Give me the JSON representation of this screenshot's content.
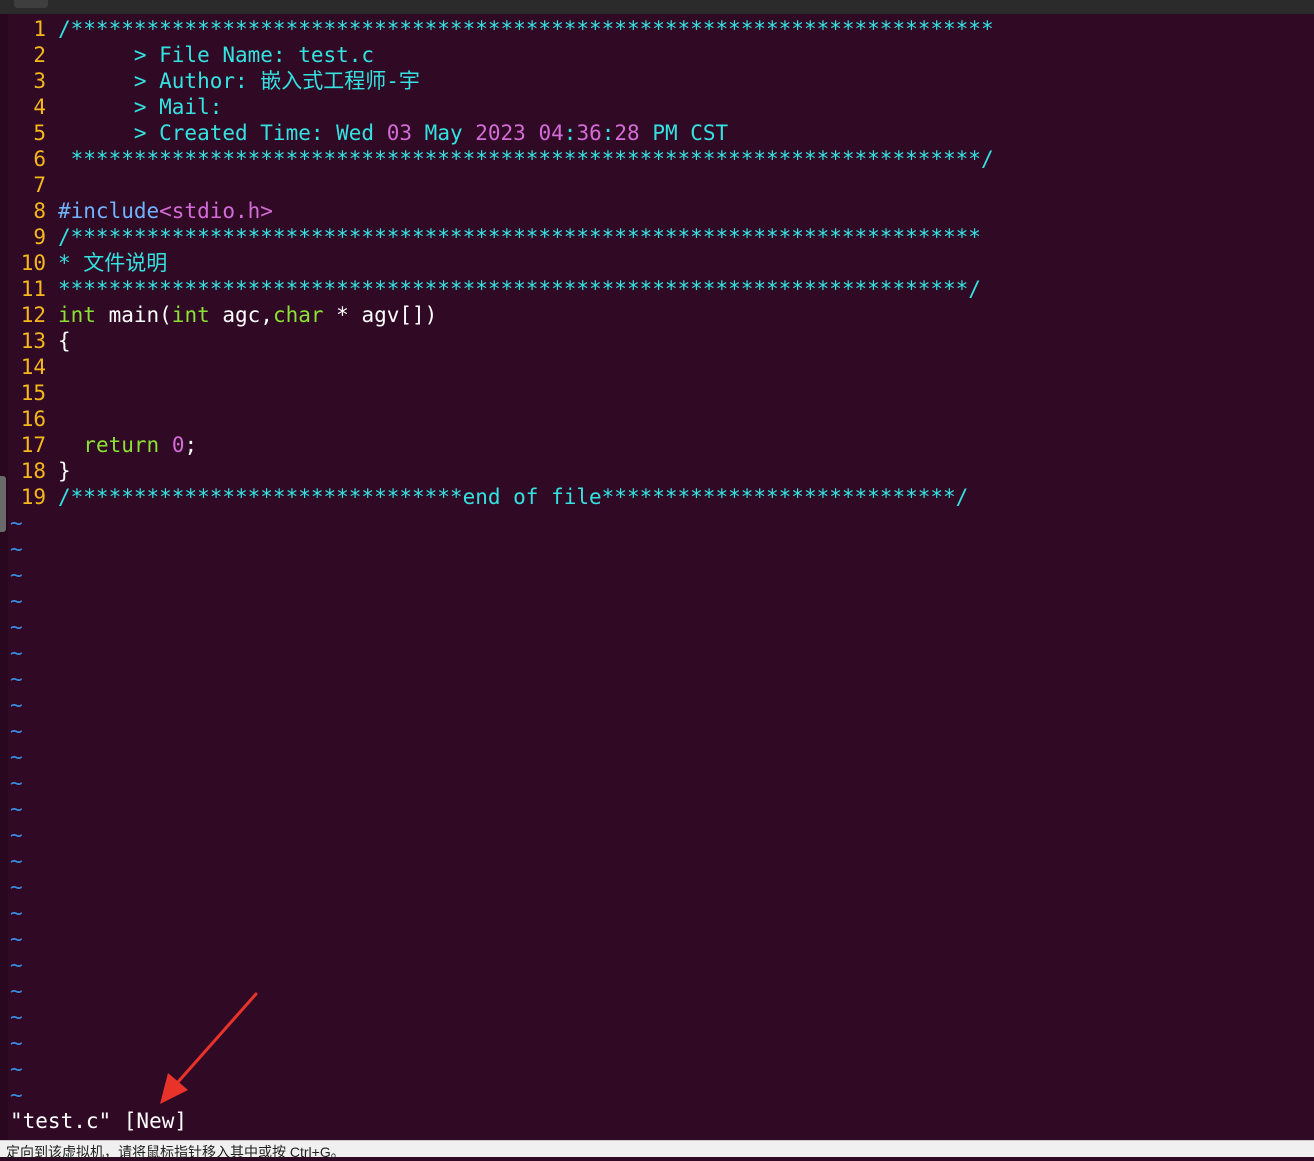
{
  "code_lines": [
    {
      "n": "1",
      "parts": [
        {
          "c": "cm",
          "t": "/*************************************************************************"
        }
      ]
    },
    {
      "n": "2",
      "parts": [
        {
          "c": "cm",
          "t": "      > File Name: test.c"
        }
      ]
    },
    {
      "n": "3",
      "parts": [
        {
          "c": "cm",
          "t": "      > Author: 嵌入式工程师-宇"
        }
      ]
    },
    {
      "n": "4",
      "parts": [
        {
          "c": "cm",
          "t": "      > Mail:"
        }
      ]
    },
    {
      "n": "5",
      "parts": [
        {
          "c": "cm",
          "t": "      > Created Time: Wed "
        },
        {
          "c": "num",
          "t": "03"
        },
        {
          "c": "cm",
          "t": " May "
        },
        {
          "c": "num",
          "t": "2023"
        },
        {
          "c": "cm",
          "t": " "
        },
        {
          "c": "num",
          "t": "04"
        },
        {
          "c": "cm",
          "t": ":"
        },
        {
          "c": "num",
          "t": "36"
        },
        {
          "c": "cm",
          "t": ":"
        },
        {
          "c": "num",
          "t": "28"
        },
        {
          "c": "cm",
          "t": " PM CST"
        }
      ]
    },
    {
      "n": "6",
      "parts": [
        {
          "c": "cm",
          "t": " ************************************************************************/"
        }
      ]
    },
    {
      "n": "7",
      "parts": []
    },
    {
      "n": "8",
      "parts": [
        {
          "c": "pre",
          "t": "#include"
        },
        {
          "c": "str",
          "t": "<stdio.h>"
        }
      ]
    },
    {
      "n": "9",
      "parts": [
        {
          "c": "cm",
          "t": "/************************************************************************"
        }
      ]
    },
    {
      "n": "10",
      "parts": [
        {
          "c": "cm",
          "t": "* 文件说明"
        }
      ]
    },
    {
      "n": "11",
      "parts": [
        {
          "c": "cm",
          "t": "************************************************************************/"
        }
      ]
    },
    {
      "n": "12",
      "parts": [
        {
          "c": "ty",
          "t": "int"
        },
        {
          "c": "",
          "t": " main("
        },
        {
          "c": "ty",
          "t": "int"
        },
        {
          "c": "",
          "t": " agc,"
        },
        {
          "c": "ty",
          "t": "char"
        },
        {
          "c": "",
          "t": " * agv[])"
        }
      ]
    },
    {
      "n": "13",
      "parts": [
        {
          "c": "",
          "t": "{"
        }
      ]
    },
    {
      "n": "14",
      "parts": []
    },
    {
      "n": "15",
      "parts": []
    },
    {
      "n": "16",
      "parts": []
    },
    {
      "n": "17",
      "parts": [
        {
          "c": "",
          "t": "  "
        },
        {
          "c": "ty",
          "t": "return"
        },
        {
          "c": "",
          "t": " "
        },
        {
          "c": "num",
          "t": "0"
        },
        {
          "c": "",
          "t": ";"
        }
      ]
    },
    {
      "n": "18",
      "parts": [
        {
          "c": "",
          "t": "}"
        }
      ]
    },
    {
      "n": "19",
      "parts": [
        {
          "c": "cm",
          "t": "/*******************************end of file****************************/"
        }
      ]
    }
  ],
  "empty_line_marker": "~",
  "empty_line_count": 23,
  "command_line": "\"test.c\" [New]",
  "status_bar_text": "定向到该虚拟机，请将鼠标指针移入其中或按 Ctrl+G。",
  "colors": {
    "background": "#300a24",
    "line_number": "#f5b81c",
    "comment": "#34e2e2",
    "preprocessor": "#6fb3ff",
    "string": "#d36bd8",
    "type_keyword": "#8ae234",
    "number": "#d36bd8",
    "tilde": "#3c8be0",
    "annotation_arrow": "#e8332a"
  }
}
